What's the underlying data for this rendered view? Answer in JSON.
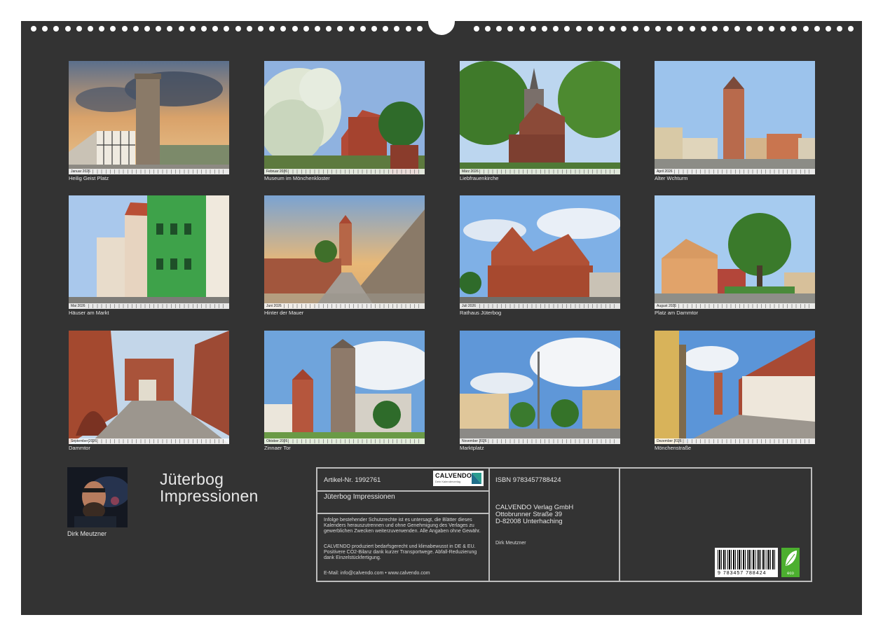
{
  "photos": [
    {
      "caption": "Heilig Geist Platz",
      "month": "Januar 2026"
    },
    {
      "caption": "Museum im Mönchenkloster",
      "month": "Februar 2026"
    },
    {
      "caption": "Liebfrauenkirche",
      "month": "März 2026"
    },
    {
      "caption": "Alter Wchturm",
      "month": "April 2026"
    },
    {
      "caption": "Häuser am Markt",
      "month": "Mai 2026"
    },
    {
      "caption": "Hinter der Mauer",
      "month": "Juni 2026"
    },
    {
      "caption": "Rathaus Jüterbog",
      "month": "Juli 2026"
    },
    {
      "caption": "Platz am Dammtor",
      "month": "August 2026"
    },
    {
      "caption": "Dammtor",
      "month": "September 2026"
    },
    {
      "caption": "Zinnaer Tor",
      "month": "Oktober 2026"
    },
    {
      "caption": "Marktplatz",
      "month": "November 2026"
    },
    {
      "caption": "Mönchenstraße",
      "month": "Dezember 2026"
    }
  ],
  "author": {
    "name": "Dirk Meutzner"
  },
  "calendar_title": {
    "line1": "Jüterbog",
    "line2": "Impressionen"
  },
  "info": {
    "article": "Artikel-Nr. 1992761",
    "logo": "CALVENDO",
    "logo_tagline": "Dein Kalenderverlag",
    "title": "Jüterbog Impressionen",
    "legal_1": "Infolge bestehender Schutzrechte ist es untersagt, die Blätter dieses Kalenders herauszutrennen und ohne Genehmigung des Verlages zu gewerblichen Zwecken weiterzuverwenden. Alle Angaben ohne Gewähr.",
    "legal_2": "CALVENDO produziert bedarfsgerecht und klimabewusst in DE & EU. Positivere CO2-Bilanz dank kurzer Transportwege. Abfall-Reduzierung dank Einzelstückfertigung.",
    "contact": "E-Mail: info@calvendo.com • www.calvendo.com",
    "isbn": "ISBN 9783457788424",
    "publisher_name": "CALVENDO Verlag GmbH",
    "publisher_street": "Ottobrunner Straße 39",
    "publisher_city": "D-82008 Unterhaching",
    "author_small": "Dirk Meutzner",
    "barcode_number": "9 783457 788424",
    "eco_label": "eco"
  },
  "colors": {
    "sheet": "#333333",
    "border": "#bdbdbd",
    "text": "#e8e8e8",
    "eco": "#4caf2f"
  }
}
